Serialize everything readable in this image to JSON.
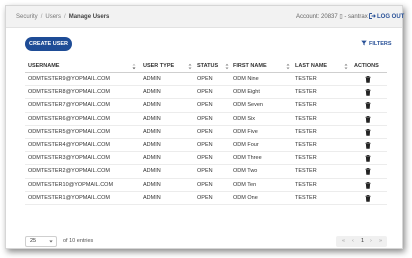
{
  "topbar": {
    "breadcrumb": [
      "Security",
      "Users",
      "Manage Users"
    ],
    "account_label": "Account: 20837",
    "account_user": "santrax",
    "logout_label": "LOG OUT"
  },
  "toolbar": {
    "create_user_label": "CREATE USER",
    "filters_label": "FILTERS"
  },
  "table": {
    "columns": [
      "USERNAME",
      "USER TYPE",
      "STATUS",
      "FIRST NAME",
      "LAST NAME",
      "ACTIONS"
    ],
    "rows": [
      {
        "username": "ODMTESTER9@YOPMAIL.COM",
        "user_type": "ADMIN",
        "status": "OPEN",
        "first_name": "ODM Nine",
        "last_name": "TESTER"
      },
      {
        "username": "ODMTESTER8@YOPMAIL.COM",
        "user_type": "ADMIN",
        "status": "OPEN",
        "first_name": "ODM Eight",
        "last_name": "TESTER"
      },
      {
        "username": "ODMTESTER7@YOPMAIL.COM",
        "user_type": "ADMIN",
        "status": "OPEN",
        "first_name": "ODM Seven",
        "last_name": "TESTER"
      },
      {
        "username": "ODMTESTER6@YOPMAIL.COM",
        "user_type": "ADMIN",
        "status": "OPEN",
        "first_name": "ODM Six",
        "last_name": "TESTER"
      },
      {
        "username": "ODMTESTER5@YOPMAIL.COM",
        "user_type": "ADMIN",
        "status": "OPEN",
        "first_name": "ODM Five",
        "last_name": "TESTER"
      },
      {
        "username": "ODMTESTER4@YOPMAIL.COM",
        "user_type": "ADMIN",
        "status": "OPEN",
        "first_name": "ODM Four",
        "last_name": "TESTER"
      },
      {
        "username": "ODMTESTER3@YOPMAIL.COM",
        "user_type": "ADMIN",
        "status": "OPEN",
        "first_name": "ODM Three",
        "last_name": "TESTER"
      },
      {
        "username": "ODMTESTER2@YOPMAIL.COM",
        "user_type": "ADMIN",
        "status": "OPEN",
        "first_name": "ODM Two",
        "last_name": "TESTER"
      },
      {
        "username": "ODMTESTER10@YOPMAIL.COM",
        "user_type": "ADMIN",
        "status": "OPEN",
        "first_name": "ODM Ten",
        "last_name": "TESTER"
      },
      {
        "username": "ODMTESTER1@YOPMAIL.COM",
        "user_type": "ADMIN",
        "status": "OPEN",
        "first_name": "ODM One",
        "last_name": "TESTER"
      }
    ]
  },
  "pagination": {
    "page_size": "25",
    "entries_label": "of 10 entries",
    "first": "«",
    "prev": "‹",
    "current_page": "1",
    "next": "›",
    "last": "»"
  },
  "icons": {
    "row_action": "trash-icon",
    "logout": "logout-icon",
    "filters": "filter-icon",
    "sort": "sort-icon"
  },
  "colors": {
    "primary": "#1e4c96",
    "link": "#2a5298",
    "topbar_bg": "#f2f2f2"
  }
}
